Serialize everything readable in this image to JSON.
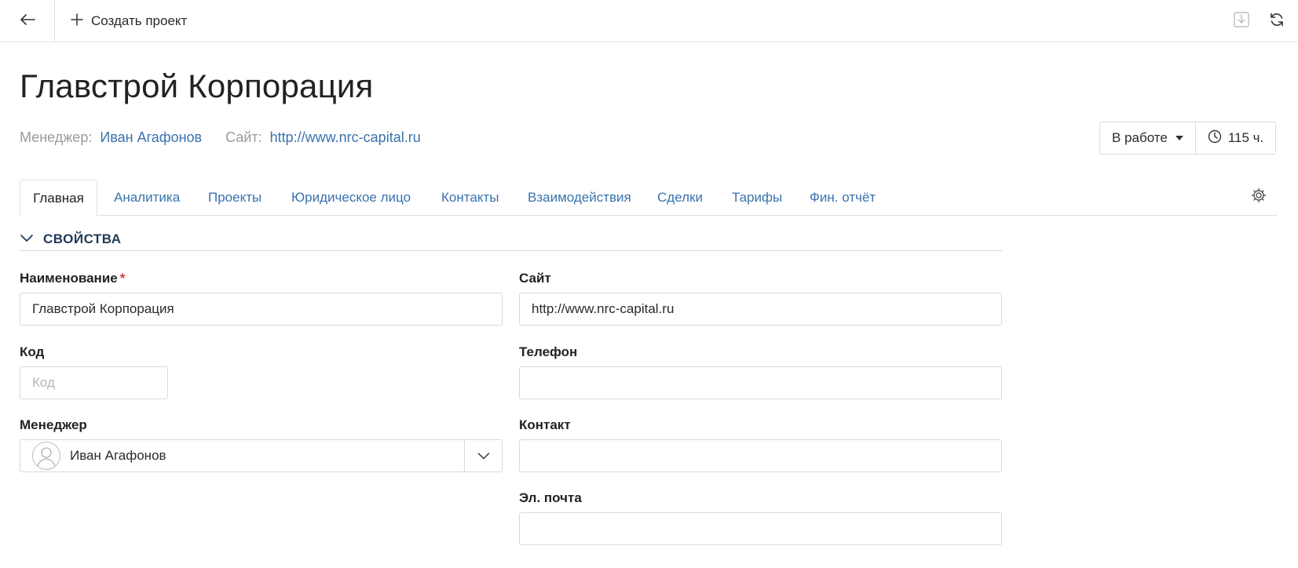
{
  "toolbar": {
    "back_icon": "arrow-left-icon",
    "create_label": "Создать проект",
    "create_icon": "plus-icon",
    "export_icon": "download-icon",
    "refresh_icon": "refresh-icon"
  },
  "header": {
    "title": "Главстрой Корпорация",
    "manager_label": "Менеджер:",
    "manager_value": "Иван Агафонов",
    "site_label": "Сайт:",
    "site_value": "http://www.nrc-capital.ru",
    "status": "В работе",
    "hours": "115 ч."
  },
  "tabs": [
    {
      "label": "Главная",
      "active": true
    },
    {
      "label": "Аналитика",
      "active": false
    },
    {
      "label": "Проекты",
      "active": false
    },
    {
      "label": "Юридическое лицо",
      "active": false
    },
    {
      "label": "Контакты",
      "active": false
    },
    {
      "label": "Взаимодействия",
      "active": false
    },
    {
      "label": "Сделки",
      "active": false
    },
    {
      "label": "Тарифы",
      "active": false
    },
    {
      "label": "Фин. отчёт",
      "active": false
    }
  ],
  "section": {
    "title": "СВОЙСТВА"
  },
  "form": {
    "name": {
      "label": "Наименование",
      "required_mark": "*",
      "value": "Главстрой Корпорация"
    },
    "code": {
      "label": "Код",
      "placeholder": "Код",
      "value": ""
    },
    "manager": {
      "label": "Менеджер",
      "value": "Иван Агафонов"
    },
    "site": {
      "label": "Сайт",
      "value": "http://www.nrc-capital.ru"
    },
    "phone": {
      "label": "Телефон",
      "value": ""
    },
    "contact": {
      "label": "Контакт",
      "value": ""
    },
    "email": {
      "label": "Эл. почта",
      "value": ""
    }
  },
  "colors": {
    "link": "#3a72ad",
    "required": "#d23c3c",
    "section_title": "#1f3a57"
  }
}
